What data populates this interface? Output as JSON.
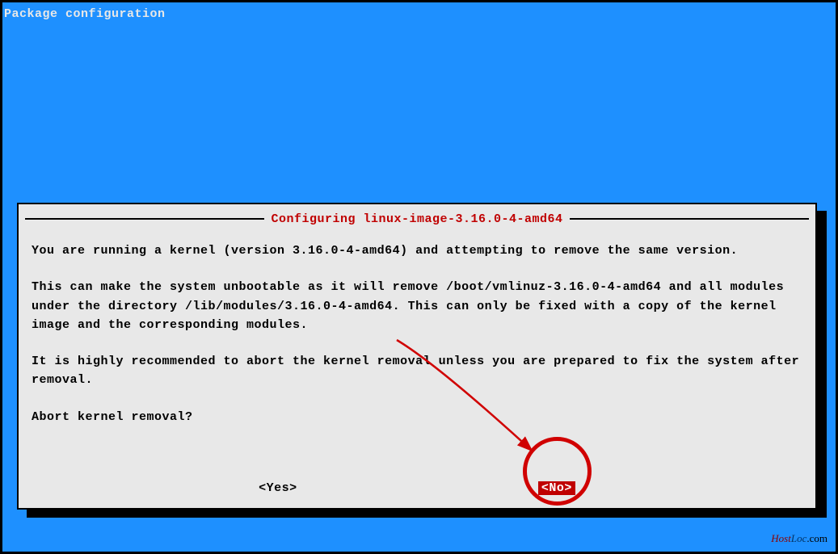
{
  "header": {
    "title": "Package configuration"
  },
  "dialog": {
    "title": " Configuring linux-image-3.16.0-4-amd64 ",
    "para1": "You are running a kernel (version 3.16.0-4-amd64) and attempting to remove the same version.",
    "para2": "This can make the system unbootable as it will remove /boot/vmlinuz-3.16.0-4-amd64 and all modules under the directory /lib/modules/3.16.0-4-amd64. This can only be fixed with a copy of the kernel image and the corresponding modules.",
    "para3": "It is highly recommended to abort the kernel removal unless you are prepared to fix the system after removal.",
    "prompt": "Abort kernel removal?",
    "yes_label": "<Yes>",
    "no_label": "<No>"
  },
  "watermark": {
    "brand1": "Host",
    "brand2": "Loc",
    "suffix": ".com"
  }
}
